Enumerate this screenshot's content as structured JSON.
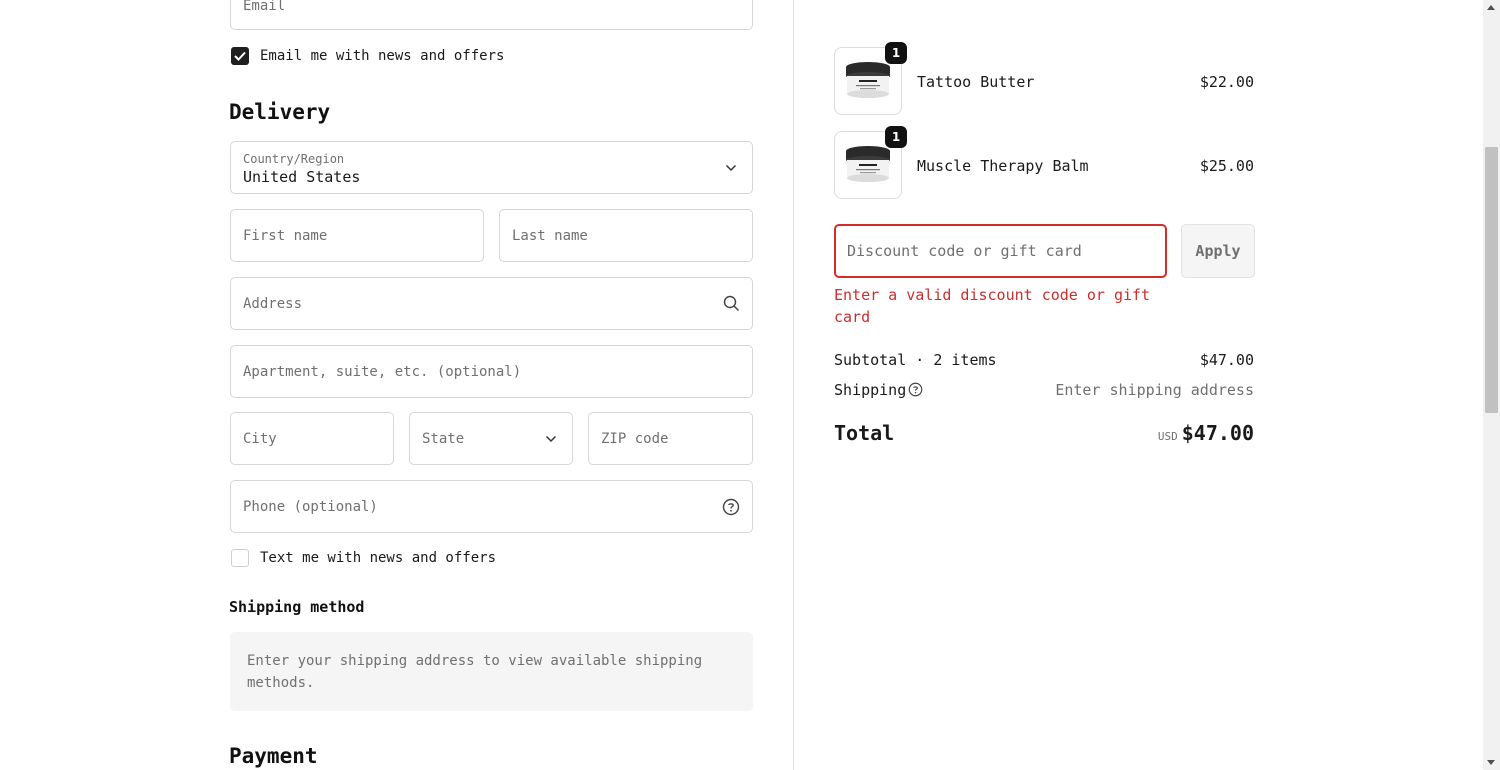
{
  "contact": {
    "email_placeholder": "Email",
    "email_offers_label": "Email me with news and offers",
    "email_offers_checked": true
  },
  "delivery": {
    "heading": "Delivery",
    "country_label": "Country/Region",
    "country_value": "United States",
    "first_name_placeholder": "First name",
    "last_name_placeholder": "Last name",
    "address_placeholder": "Address",
    "apartment_placeholder": "Apartment, suite, etc. (optional)",
    "city_placeholder": "City",
    "state_placeholder": "State",
    "zip_placeholder": "ZIP code",
    "phone_placeholder": "Phone (optional)",
    "text_offers_label": "Text me with news and offers",
    "text_offers_checked": false
  },
  "shipping_method": {
    "heading": "Shipping method",
    "message": "Enter your shipping address to view available shipping methods."
  },
  "payment": {
    "heading": "Payment"
  },
  "order": {
    "items": [
      {
        "name": "Tattoo Butter",
        "price": "$22.00",
        "quantity": "1"
      },
      {
        "name": "Muscle Therapy Balm",
        "price": "$25.00",
        "quantity": "1"
      }
    ],
    "discount_placeholder": "Discount code or gift card",
    "apply_label": "Apply",
    "discount_error": "Enter a valid discount code or gift card",
    "subtotal_label": "Subtotal · 2 items",
    "subtotal_value": "$47.00",
    "shipping_label": "Shipping",
    "shipping_value": "Enter shipping address",
    "total_label": "Total",
    "currency": "USD",
    "total_value": "$47.00"
  },
  "colors": {
    "error": "#d12d2d",
    "text": "#1a1a1a",
    "muted": "#707070"
  }
}
